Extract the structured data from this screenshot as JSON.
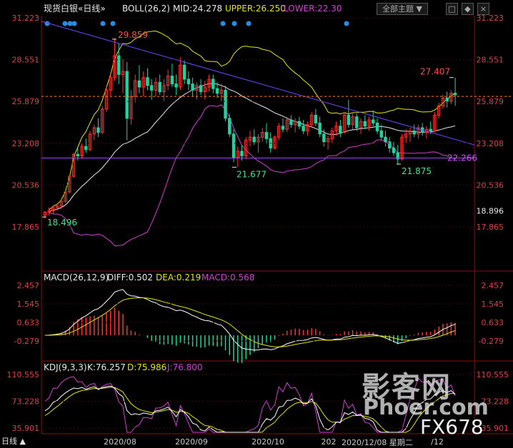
{
  "header": {
    "symbol": "现货白银",
    "period": "«日线»",
    "boll_label": "BOLL(26,2)",
    "mid": "MID:24.278",
    "upper": "UPPER:26.250",
    "lower": "LOWER:22.30",
    "theme_button": "全部主题 ▼",
    "min_button": "□",
    "pin_button": "◆",
    "close_button": "×"
  },
  "price_panel": {
    "yaxis_ticks": [
      "31.223",
      "28.551",
      "25.879",
      "23.208",
      "20.536",
      "17.865"
    ],
    "current_price_label": "18.896",
    "annotations": [
      {
        "text": "29.859",
        "color": "#ff4d4d"
      },
      {
        "text": "27.407",
        "color": "#ff4d4d"
      },
      {
        "text": "21.677",
        "color": "#4de08a"
      },
      {
        "text": "21.875",
        "color": "#4de08a"
      },
      {
        "text": "18.496",
        "color": "#4de08a"
      },
      {
        "text": "22.266",
        "color": "#d24dff"
      }
    ]
  },
  "macd_panel": {
    "label": "MACD(26,12,9)",
    "diff": "DIFF:0.502",
    "dea": "DEA:0.219",
    "macd": "MACD:0.568",
    "yaxis_ticks": [
      "2.457",
      "1.545",
      "0.633",
      "-0.279"
    ]
  },
  "kdj_panel": {
    "label": "KDJ(9,3,3)",
    "k": "K:76.257",
    "d": "D:75.986",
    "j": "J:76.800",
    "yaxis_ticks": [
      "110.555",
      "73.228",
      "35.901"
    ]
  },
  "xaxis": {
    "labels": [
      "2020/08",
      "2020/09",
      "2020/10",
      "202",
      "2020/12/08 星期二",
      "/12"
    ]
  },
  "footer": {
    "period_tab": "日线 ▲",
    "timestamp": "2020/12/08 星期二"
  },
  "watermark": {
    "cn": "影客网",
    "en": "Phoer.com",
    "fx": "FX678"
  },
  "colors": {
    "up": "#ff3030",
    "down": "#1fd3a0",
    "mid_line": "#e8e8e8",
    "upper_line": "#e6e600",
    "lower_line": "#d040d0",
    "trend_line": "#6a4dff",
    "support_line": "#a040ff",
    "dashed_price": "#ff7f2a",
    "diff_line": "#ffffff",
    "dea_line": "#e6e600",
    "macd_up": "#ff3030",
    "macd_down": "#1fd3a0",
    "k_line": "#ffffff",
    "d_line": "#e6e600",
    "j_line": "#d040d0"
  },
  "chart_data": {
    "type": "candlestick",
    "price_range": [
      17.865,
      31.223
    ],
    "candles_ohlc": [
      [
        18.6,
        18.9,
        18.4,
        18.8
      ],
      [
        18.8,
        19.1,
        18.6,
        18.9
      ],
      [
        18.9,
        19.2,
        18.7,
        19.1
      ],
      [
        19.1,
        19.4,
        18.9,
        19.2
      ],
      [
        19.2,
        19.6,
        19.0,
        19.5
      ],
      [
        19.5,
        20.2,
        19.4,
        20.1
      ],
      [
        20.1,
        21.2,
        20.0,
        21.1
      ],
      [
        21.1,
        22.6,
        21.0,
        22.5
      ],
      [
        22.5,
        22.9,
        22.1,
        22.4
      ],
      [
        22.4,
        23.2,
        22.2,
        23.0
      ],
      [
        23.0,
        23.5,
        22.6,
        22.8
      ],
      [
        22.8,
        24.0,
        22.7,
        23.8
      ],
      [
        23.8,
        24.4,
        23.4,
        24.2
      ],
      [
        24.2,
        24.8,
        23.6,
        23.9
      ],
      [
        23.9,
        25.6,
        23.8,
        25.4
      ],
      [
        25.4,
        26.8,
        25.2,
        26.6
      ],
      [
        26.6,
        27.6,
        26.2,
        27.4
      ],
      [
        27.4,
        29.9,
        27.2,
        28.8
      ],
      [
        28.8,
        29.6,
        27.0,
        27.6
      ],
      [
        27.6,
        28.6,
        26.4,
        27.8
      ],
      [
        27.8,
        28.4,
        23.4,
        24.8
      ],
      [
        24.8,
        26.6,
        24.4,
        26.2
      ],
      [
        26.2,
        27.6,
        25.8,
        27.2
      ],
      [
        27.2,
        28.2,
        26.4,
        26.8
      ],
      [
        26.8,
        27.8,
        26.2,
        27.4
      ],
      [
        27.4,
        28.0,
        26.6,
        26.9
      ],
      [
        26.9,
        27.3,
        26.0,
        26.6
      ],
      [
        26.6,
        27.4,
        26.2,
        27.1
      ],
      [
        27.1,
        27.6,
        26.3,
        26.5
      ],
      [
        26.5,
        27.3,
        25.9,
        26.9
      ],
      [
        26.9,
        27.9,
        26.6,
        27.5
      ],
      [
        27.5,
        28.3,
        26.8,
        27.0
      ],
      [
        27.0,
        27.6,
        26.3,
        26.8
      ],
      [
        26.8,
        28.7,
        26.6,
        28.2
      ],
      [
        28.2,
        28.5,
        27.0,
        27.3
      ],
      [
        27.3,
        27.8,
        26.6,
        27.0
      ],
      [
        27.0,
        27.4,
        26.2,
        26.6
      ],
      [
        26.6,
        27.1,
        26.0,
        26.9
      ],
      [
        26.9,
        27.3,
        26.3,
        26.5
      ],
      [
        26.5,
        27.2,
        26.0,
        26.8
      ],
      [
        26.8,
        27.6,
        26.5,
        27.3
      ],
      [
        27.3,
        27.6,
        26.4,
        26.7
      ],
      [
        26.7,
        27.1,
        26.1,
        26.4
      ],
      [
        26.4,
        27.0,
        25.9,
        26.6
      ],
      [
        26.6,
        26.9,
        24.6,
        24.8
      ],
      [
        24.8,
        25.1,
        23.6,
        23.8
      ],
      [
        23.8,
        24.1,
        22.0,
        22.3
      ],
      [
        22.3,
        23.0,
        21.7,
        22.7
      ],
      [
        22.7,
        23.1,
        22.1,
        22.4
      ],
      [
        22.4,
        23.6,
        22.2,
        23.4
      ],
      [
        23.4,
        24.0,
        23.0,
        23.6
      ],
      [
        23.6,
        24.1,
        23.1,
        23.3
      ],
      [
        23.3,
        23.8,
        22.6,
        23.6
      ],
      [
        23.6,
        24.2,
        23.3,
        23.9
      ],
      [
        23.9,
        24.5,
        23.2,
        23.5
      ],
      [
        23.5,
        23.9,
        22.6,
        22.9
      ],
      [
        22.9,
        23.7,
        22.8,
        23.6
      ],
      [
        23.6,
        24.5,
        23.4,
        24.3
      ],
      [
        24.3,
        24.8,
        23.9,
        24.1
      ],
      [
        24.1,
        24.9,
        23.9,
        24.7
      ],
      [
        24.7,
        25.0,
        24.2,
        24.4
      ],
      [
        24.4,
        24.8,
        23.9,
        24.6
      ],
      [
        24.6,
        24.9,
        24.1,
        24.3
      ],
      [
        24.3,
        24.7,
        23.8,
        24.0
      ],
      [
        24.0,
        24.6,
        23.7,
        24.4
      ],
      [
        24.4,
        25.2,
        24.2,
        25.0
      ],
      [
        25.0,
        25.4,
        24.3,
        24.5
      ],
      [
        24.5,
        24.9,
        23.6,
        23.8
      ],
      [
        23.8,
        24.1,
        23.0,
        23.3
      ],
      [
        23.3,
        23.7,
        22.8,
        23.5
      ],
      [
        23.5,
        24.2,
        23.2,
        24.0
      ],
      [
        24.0,
        24.6,
        23.7,
        24.3
      ],
      [
        24.3,
        24.7,
        23.6,
        23.9
      ],
      [
        23.9,
        25.2,
        23.8,
        25.0
      ],
      [
        25.0,
        26.0,
        24.2,
        24.4
      ],
      [
        24.4,
        25.2,
        24.1,
        24.9
      ],
      [
        24.9,
        25.1,
        24.0,
        24.2
      ],
      [
        24.2,
        24.8,
        23.8,
        24.6
      ],
      [
        24.6,
        25.0,
        24.1,
        24.3
      ],
      [
        24.3,
        24.9,
        24.0,
        24.7
      ],
      [
        24.7,
        25.3,
        24.3,
        24.5
      ],
      [
        24.5,
        24.8,
        23.8,
        24.0
      ],
      [
        24.0,
        24.4,
        23.4,
        23.6
      ],
      [
        23.6,
        24.0,
        23.0,
        23.3
      ],
      [
        23.3,
        23.6,
        22.6,
        22.9
      ],
      [
        22.9,
        23.3,
        22.4,
        22.6
      ],
      [
        22.6,
        23.1,
        21.9,
        22.2
      ],
      [
        22.2,
        23.8,
        22.1,
        23.6
      ],
      [
        23.6,
        24.1,
        23.2,
        23.8
      ],
      [
        23.8,
        24.2,
        23.3,
        24.0
      ],
      [
        24.0,
        24.4,
        23.6,
        23.8
      ],
      [
        23.8,
        24.4,
        23.5,
        24.2
      ],
      [
        24.2,
        24.5,
        23.7,
        23.9
      ],
      [
        23.9,
        24.3,
        23.5,
        24.1
      ],
      [
        24.1,
        24.6,
        23.8,
        24.0
      ],
      [
        24.0,
        25.2,
        23.9,
        25.0
      ],
      [
        25.0,
        25.8,
        24.8,
        25.6
      ],
      [
        25.6,
        26.3,
        25.4,
        26.1
      ],
      [
        26.1,
        26.5,
        25.5,
        25.9
      ],
      [
        25.9,
        26.6,
        25.7,
        26.4
      ],
      [
        26.4,
        27.4,
        25.6,
        26.3
      ]
    ],
    "annotations": {
      "high_aug": 29.859,
      "low_start": 18.496,
      "low_sep": 21.677,
      "low_nov": 21.875,
      "recent_high": 27.407,
      "support": 22.266
    },
    "macd_range": [
      -0.279,
      2.457
    ],
    "kdj_range": [
      35.901,
      110.555
    ],
    "x_labels": [
      "2020/08",
      "2020/09",
      "2020/10",
      "2020/11",
      "2020/12"
    ]
  }
}
